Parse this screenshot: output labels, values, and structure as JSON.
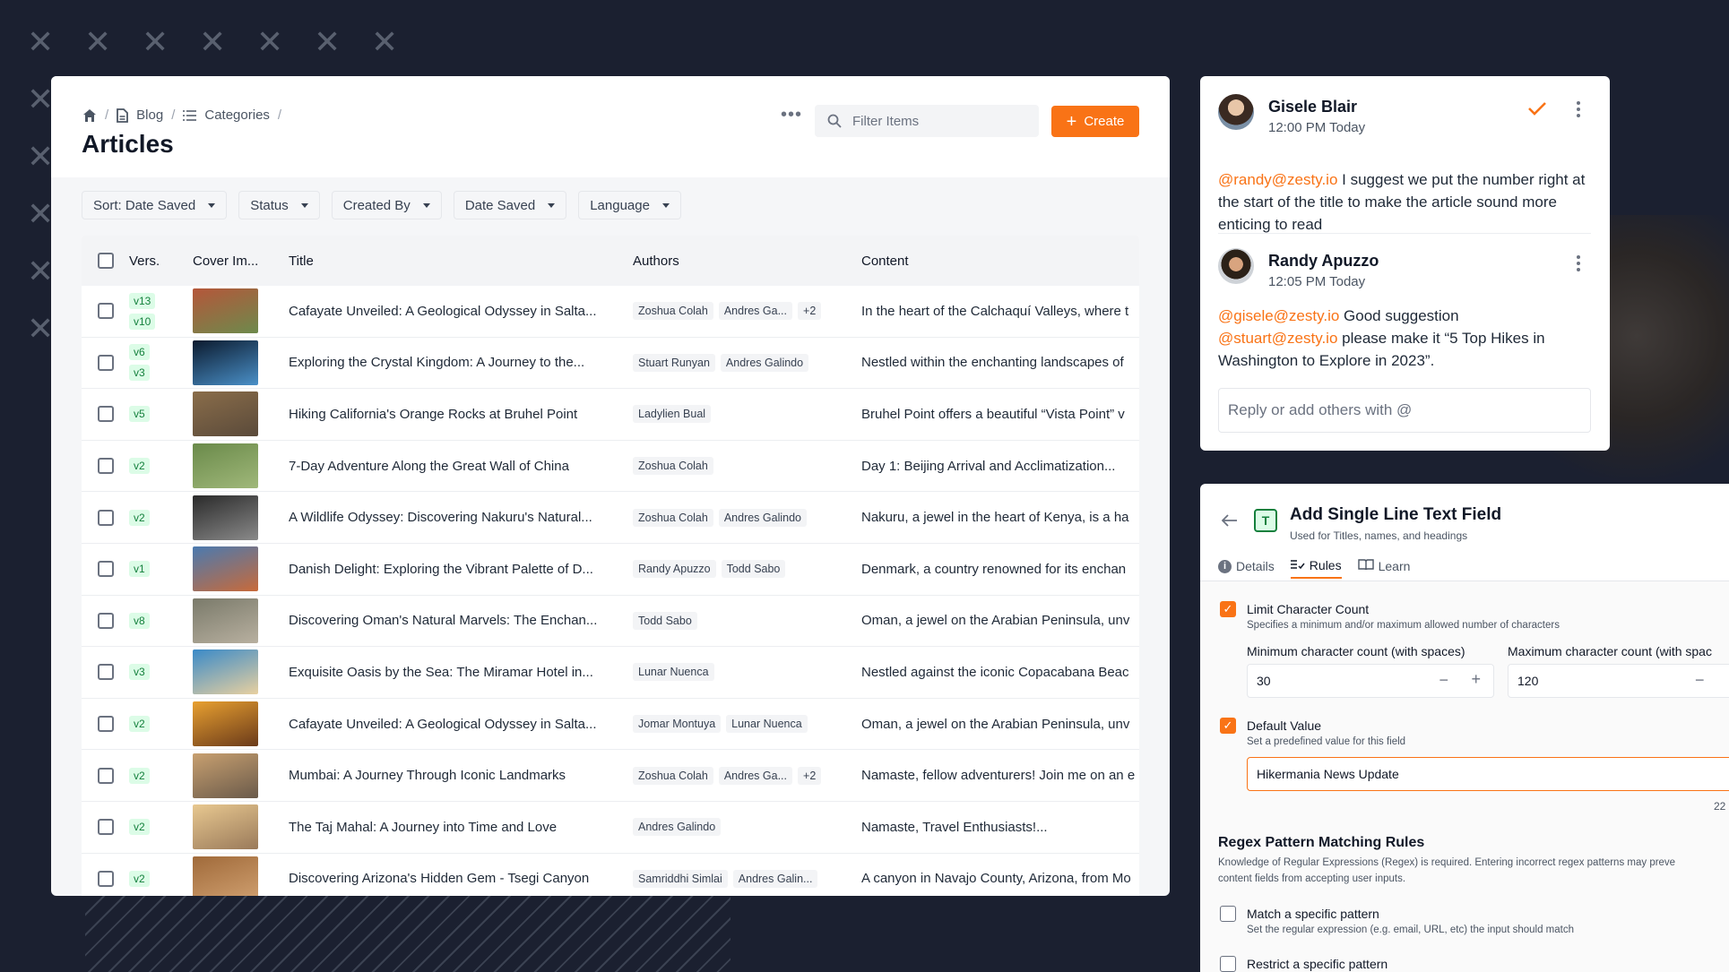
{
  "breadcrumb": {
    "items": [
      "Blog",
      "Categories"
    ]
  },
  "page": {
    "title": "Articles"
  },
  "toolbar": {
    "more": "•••",
    "search_placeholder": "Filter Items",
    "create_label": "Create"
  },
  "filters": [
    "Sort: Date Saved",
    "Status",
    "Created By",
    "Date Saved",
    "Language"
  ],
  "table": {
    "columns": [
      "Vers.",
      "Cover Im...",
      "Title",
      "Authors",
      "Content"
    ],
    "rows": [
      {
        "versions": [
          "v13",
          "v10"
        ],
        "title": "Cafayate Unveiled: A Geological Odyssey in Salta...",
        "authors": [
          "Zoshua Colah",
          "Andres Ga...",
          "+2"
        ],
        "content": "In the heart of the Calchaquí Valleys, where t"
      },
      {
        "versions": [
          "v6",
          "v3"
        ],
        "title": "Exploring the Crystal Kingdom: A Journey to the...",
        "authors": [
          "Stuart Runyan",
          "Andres Galindo"
        ],
        "content": "Nestled within the enchanting landscapes of"
      },
      {
        "versions": [
          "v5"
        ],
        "title": "Hiking California's Orange Rocks at Bruhel Point",
        "authors": [
          "Ladylien Bual"
        ],
        "content": "Bruhel Point offers a beautiful “Vista Point” v"
      },
      {
        "versions": [
          "v2"
        ],
        "title": "7-Day Adventure Along the Great Wall of China",
        "authors": [
          "Zoshua Colah"
        ],
        "content": "Day 1: Beijing Arrival and Acclimatization..."
      },
      {
        "versions": [
          "v2"
        ],
        "title": "A Wildlife Odyssey: Discovering Nakuru's Natural...",
        "authors": [
          "Zoshua Colah",
          "Andres Galindo"
        ],
        "content": "Nakuru, a jewel in the heart of Kenya, is a ha"
      },
      {
        "versions": [
          "v1"
        ],
        "title": "Danish Delight: Exploring the Vibrant Palette of D...",
        "authors": [
          "Randy Apuzzo",
          "Todd Sabo"
        ],
        "content": "Denmark, a country renowned for its enchan"
      },
      {
        "versions": [
          "v8"
        ],
        "title": "Discovering Oman's Natural Marvels: The Enchan...",
        "authors": [
          "Todd Sabo"
        ],
        "content": "Oman, a jewel on the Arabian Peninsula, unv"
      },
      {
        "versions": [
          "v3"
        ],
        "title": "Exquisite Oasis by the Sea: The Miramar Hotel in...",
        "authors": [
          "Lunar Nuenca"
        ],
        "content": "Nestled against the iconic Copacabana Beac"
      },
      {
        "versions": [
          "v2"
        ],
        "title": "Cafayate Unveiled: A Geological Odyssey in Salta...",
        "authors": [
          "Jomar Montuya",
          "Lunar Nuenca"
        ],
        "content": "Oman, a jewel on the Arabian Peninsula, unv"
      },
      {
        "versions": [
          "v2"
        ],
        "title": "Mumbai: A Journey Through Iconic Landmarks",
        "authors": [
          "Zoshua Colah",
          "Andres Ga...",
          "+2"
        ],
        "content": "Namaste, fellow adventurers! Join me on an e"
      },
      {
        "versions": [
          "v2"
        ],
        "title": "The Taj Mahal: A Journey into Time and Love",
        "authors": [
          "Andres Galindo"
        ],
        "content": "Namaste, Travel Enthusiasts!..."
      },
      {
        "versions": [
          "v2"
        ],
        "title": "Discovering Arizona's Hidden Gem - Tsegi Canyon",
        "authors": [
          "Samriddhi Simlai",
          "Andres Galin..."
        ],
        "content": "A canyon in Navajo County, Arizona, from Mo"
      }
    ]
  },
  "comments": [
    {
      "name": "Gisele Blair",
      "time": "12:00 PM Today",
      "mention1": "@randy@zesty.io",
      "text": " I suggest we put the number right at the start of the title to make the article sound more enticing to read"
    },
    {
      "name": "Randy Apuzzo",
      "time": "12:05 PM Today",
      "mention1": "@gisele@zesty.io",
      "text1": " Good suggestion",
      "mention2": "@stuart@zesty.io",
      "text2": " please make it “5 Top Hikes in Washington to Explore in 2023”."
    }
  ],
  "reply_placeholder": "Reply or add others with @",
  "field_panel": {
    "icon_letter": "T",
    "title": "Add Single Line Text Field",
    "subtitle": "Used for Titles, names, and headings",
    "tabs": [
      "Details",
      "Rules",
      "Learn"
    ],
    "limit": {
      "label": "Limit Character Count",
      "desc": "Specifies a minimum and/or maximum allowed number of characters",
      "min_label": "Minimum character count (with spaces)",
      "max_label": "Maximum character count (with spac",
      "min_value": "30",
      "max_value": "120"
    },
    "default": {
      "label": "Default Value",
      "desc": "Set a predefined value for this field",
      "value": "Hikermania News Update",
      "count": "22"
    },
    "regex": {
      "heading": "Regex Pattern Matching Rules",
      "desc1": "Knowledge of Regular Expressions (Regex) is required. Entering incorrect regex patterns may preve",
      "desc2": "content fields from accepting user inputs.",
      "match_label": "Match a specific pattern",
      "match_desc": "Set the regular expression (e.g. email, URL, etc) the input should match",
      "restrict_label": "Restrict a specific pattern"
    }
  },
  "colors": {
    "accent": "#f97316",
    "version_badge": "#dcfce7",
    "background": "#1b2030"
  }
}
